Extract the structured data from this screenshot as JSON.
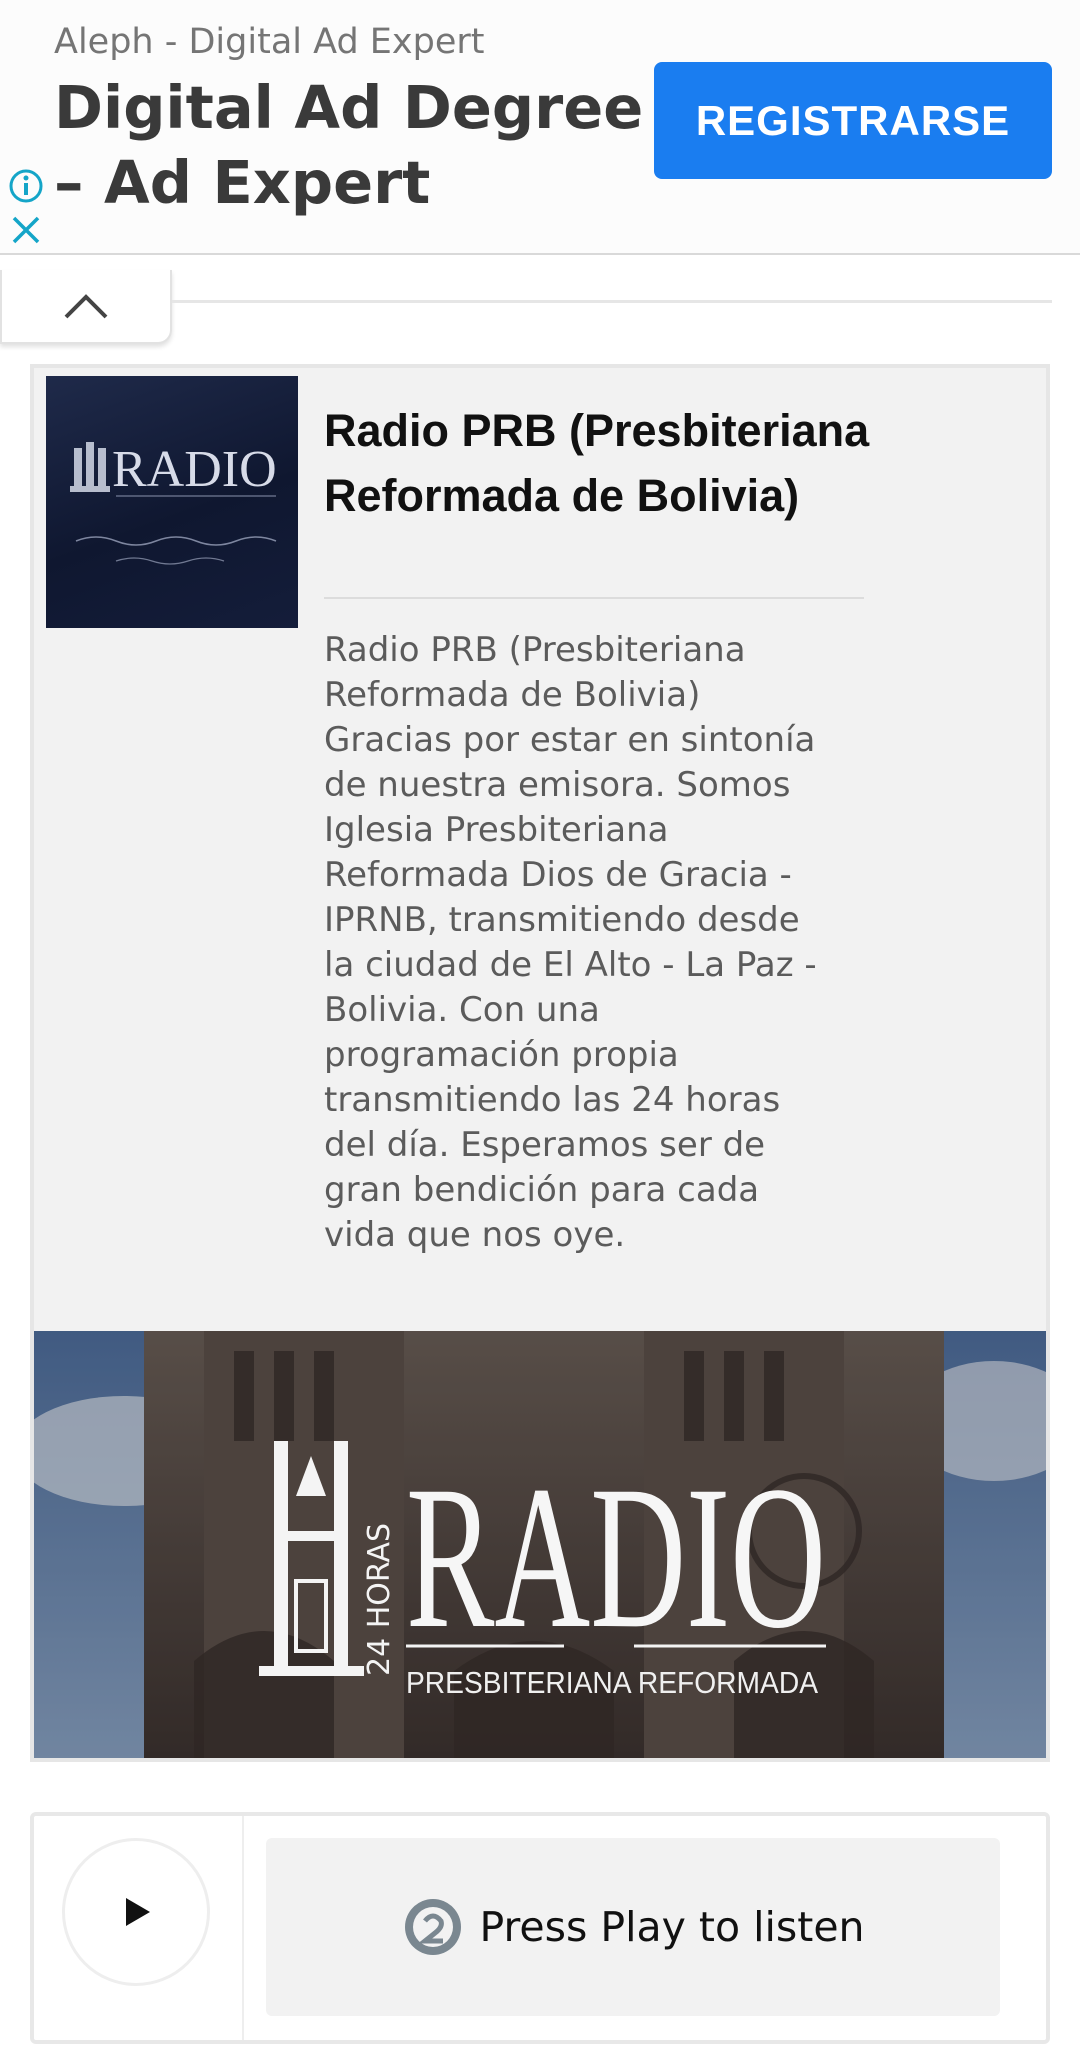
{
  "ad": {
    "advertiser": "Aleph - Digital Ad Expert",
    "headline": "Digital Ad Degree – Ad Expert",
    "cta_label": "REGISTRARSE",
    "accent_color": "#1a7df0",
    "info_icon": "info-icon",
    "close_icon": "close-icon"
  },
  "collapse": {
    "icon": "chevron-up-icon"
  },
  "station": {
    "name": "Radio PRB (Presbiteriana Reformada de Bolivia)",
    "description": "Radio PRB (Presbiteriana Reformada de Bolivia) Gracias por estar en sintonía de nuestra emisora. Somos Iglesia Presbiteriana Reformada Dios de Gracia - IPRNB, transmitiendo desde la ciudad de El Alto - La Paz - Bolivia. Con una programación propia transmitiendo las 24 horas del día. Esperamos ser de gran bendición para cada vida que nos oye.",
    "logo_text": "RADIO",
    "banner": {
      "title": "RADIO",
      "vertical_label": "24 HORAS",
      "subtitle": "PRESBITERIANA REFORMADA"
    }
  },
  "player": {
    "play_icon": "play-icon",
    "status_icon": "stream-logo-icon",
    "status_text": "Press Play to listen"
  }
}
